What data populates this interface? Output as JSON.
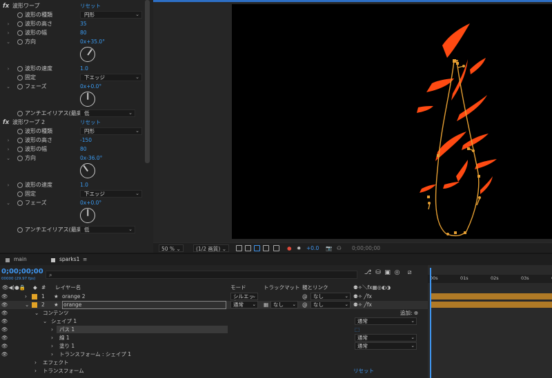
{
  "effects": [
    {
      "kind": "fx",
      "label": "波形ワープ",
      "reset": "リセット"
    },
    {
      "kind": "dd",
      "label": "波形の種類",
      "value": "円形"
    },
    {
      "kind": "val",
      "label": "波形の高さ",
      "value": "35"
    },
    {
      "kind": "val",
      "label": "波形の幅",
      "value": "80"
    },
    {
      "kind": "dial",
      "label": "方向",
      "value": "0x+35.0°",
      "angle": 35
    },
    {
      "kind": "val",
      "label": "波形の速度",
      "value": "1.0"
    },
    {
      "kind": "dd",
      "label": "固定",
      "value": "下エッジ"
    },
    {
      "kind": "dial",
      "label": "フェーズ",
      "value": "0x+0.0°",
      "angle": 0
    },
    {
      "kind": "dd",
      "label": "アンチエイリアス(最高",
      "value": "低"
    },
    {
      "kind": "fx",
      "label": "波形ワープ 2",
      "reset": "リセット"
    },
    {
      "kind": "dd",
      "label": "波形の種類",
      "value": "円形"
    },
    {
      "kind": "val",
      "label": "波形の高さ",
      "value": "-150"
    },
    {
      "kind": "val",
      "label": "波形の幅",
      "value": "80"
    },
    {
      "kind": "dial",
      "label": "方向",
      "value": "0x-36.0°",
      "angle": -36
    },
    {
      "kind": "val",
      "label": "波形の速度",
      "value": "1.0"
    },
    {
      "kind": "dd",
      "label": "固定",
      "value": "下エッジ"
    },
    {
      "kind": "dial",
      "label": "フェーズ",
      "value": "0x+0.0°",
      "angle": 0
    },
    {
      "kind": "dd",
      "label": "アンチエイリアス(最高",
      "value": "低"
    }
  ],
  "viewer_toolbar": {
    "zoom": "50 %",
    "resolution": "(1/2 画質)",
    "exposure": "+0.0",
    "timecode": "0;00;00;00"
  },
  "timeline": {
    "tabs": [
      "main",
      "sparks1"
    ],
    "current_time": "0;00;00;00",
    "fps": "00000 (29.97 fps)",
    "headers": {
      "layer_name": "レイヤー名",
      "mode": "モード",
      "trackmatte": "トラックマット",
      "parent": "親とリンク",
      "hash": "#"
    },
    "layers": [
      {
        "num": "1",
        "name": "orange 2",
        "mode": "シルエット",
        "matte": "",
        "parent": "なし"
      },
      {
        "num": "2",
        "name": "orange",
        "mode": "通常",
        "matte": "なし",
        "parent": "なし"
      }
    ],
    "props": [
      {
        "label": "コンテンツ",
        "right": "追加:"
      },
      {
        "label": "シェイプ 1",
        "right": "通常"
      },
      {
        "label": "パス 1",
        "right": ""
      },
      {
        "label": "線 1",
        "right": "通常"
      },
      {
        "label": "塗り 1",
        "right": "通常"
      },
      {
        "label": "トランスフォーム : シェイプ 1",
        "right": ""
      },
      {
        "label": "エフェクト",
        "right": ""
      },
      {
        "label": "トランスフォーム",
        "right": "リセット"
      }
    ],
    "ruler": [
      "00s",
      "01s",
      "02s",
      "03s",
      "0"
    ]
  }
}
